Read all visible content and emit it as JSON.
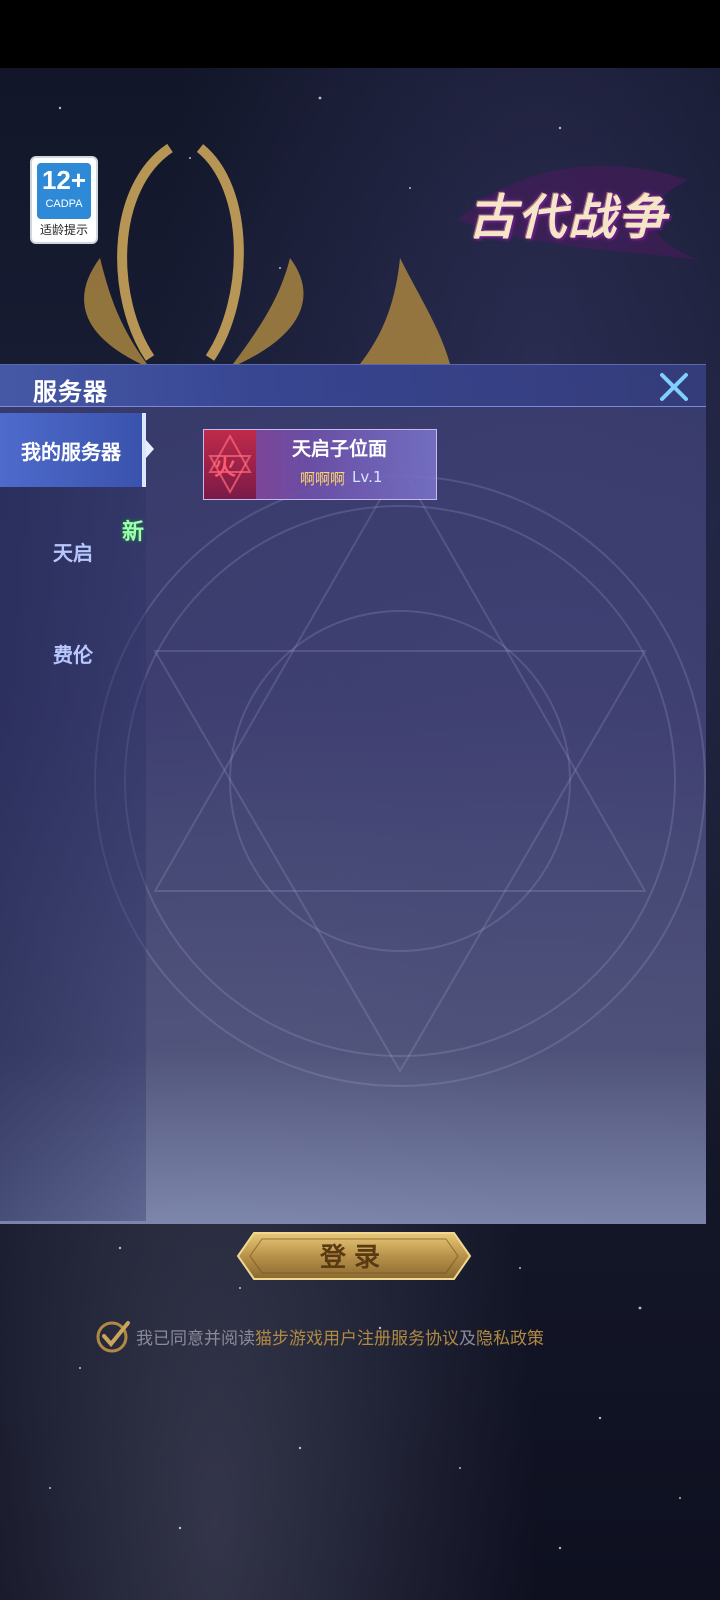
{
  "age_rating": {
    "age": "12+",
    "org": "CADPA",
    "tip": "适龄提示"
  },
  "logo": {
    "text": "古代战争"
  },
  "server_panel": {
    "title": "服务器",
    "tabs": [
      {
        "label": "我的服务器",
        "active": true
      },
      {
        "label": "天启",
        "active": false,
        "badge": "新"
      },
      {
        "label": "费伦",
        "active": false
      }
    ],
    "servers": [
      {
        "element": "火",
        "name": "天启子位面",
        "player": "啊啊啊",
        "level": "Lv.1"
      }
    ]
  },
  "login": {
    "label": "登录"
  },
  "agreement": {
    "prefix": "我已同意并阅读",
    "user_agreement": "猫步游戏用户注册服务协议",
    "conjunction": "及",
    "privacy_policy": "隐私政策",
    "checked": true
  },
  "colors": {
    "accent_gold": "#b08a44",
    "panel_blue": "#3a3e70",
    "new_green": "#9fffb0"
  }
}
